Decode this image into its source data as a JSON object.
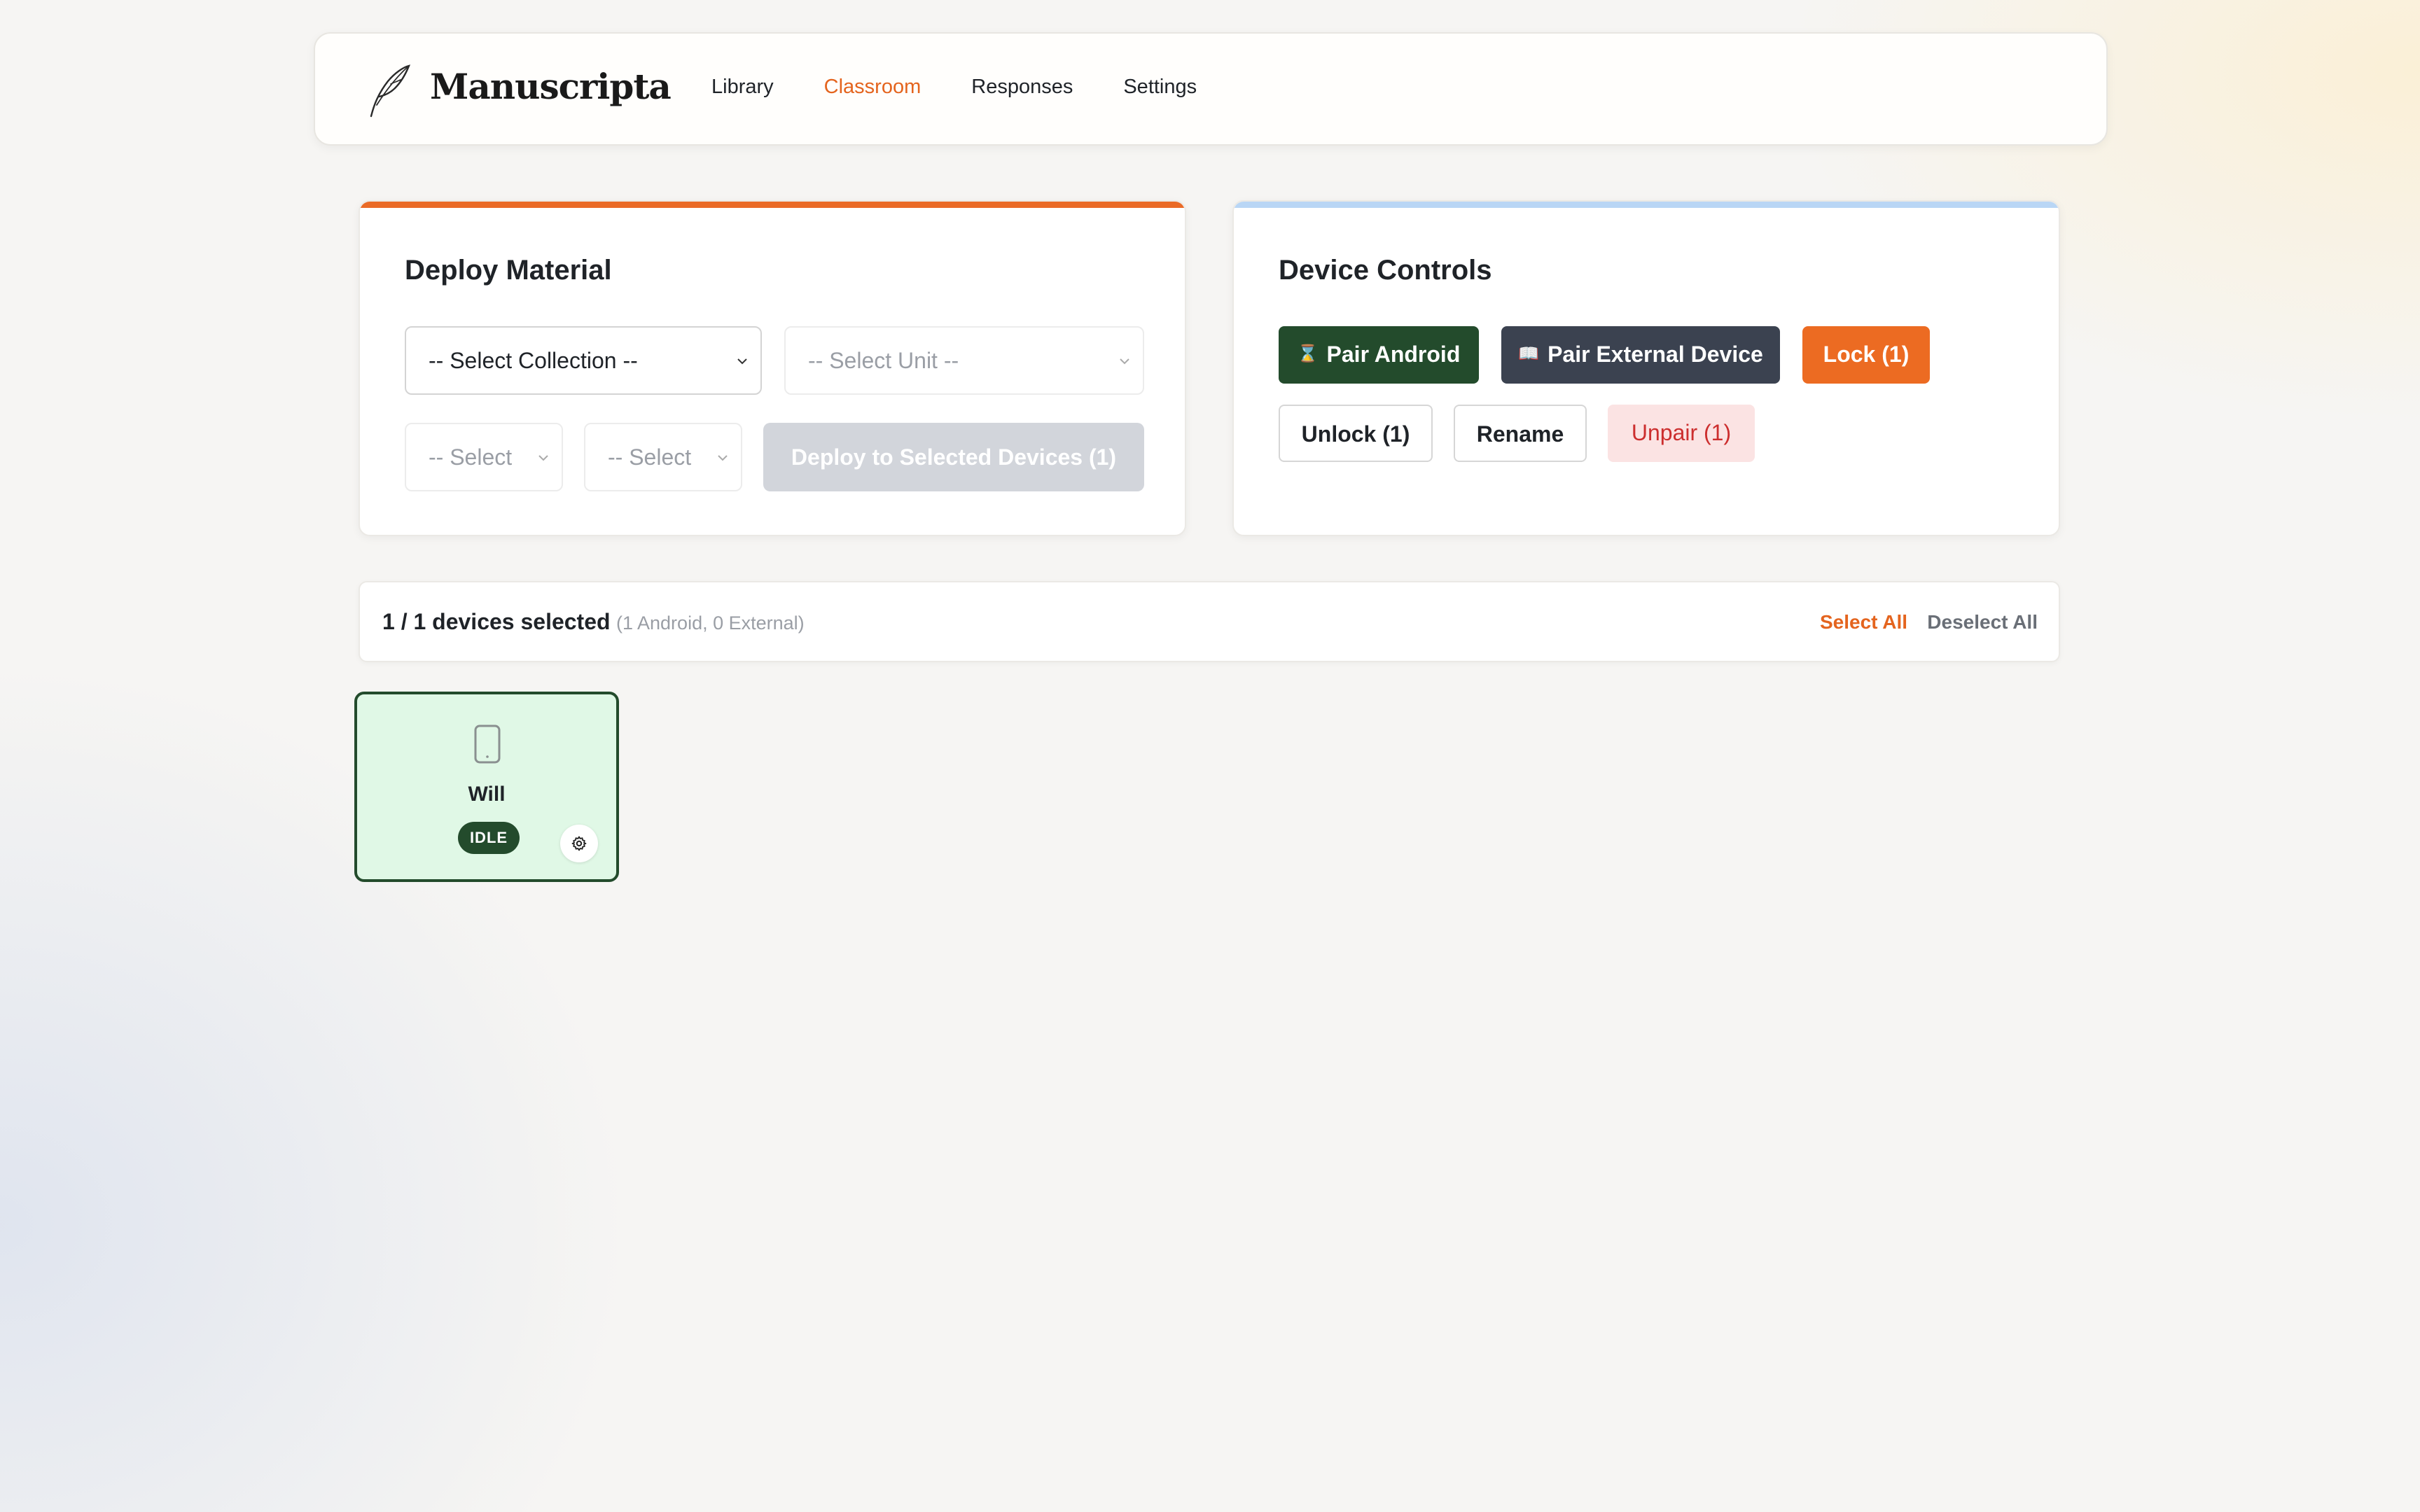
{
  "app": {
    "brand": "Manuscripta"
  },
  "nav": {
    "items": [
      {
        "label": "Library",
        "active": false
      },
      {
        "label": "Classroom",
        "active": true
      },
      {
        "label": "Responses",
        "active": false
      },
      {
        "label": "Settings",
        "active": false
      }
    ]
  },
  "deploy": {
    "title": "Deploy Material",
    "collection": {
      "value": "-- Select Collection --"
    },
    "unit": {
      "value": "-- Select Unit --"
    },
    "select_a": {
      "value": "-- Select"
    },
    "select_b": {
      "value": "-- Select"
    },
    "deploy_button": "Deploy to Selected Devices (1)"
  },
  "controls": {
    "title": "Device Controls",
    "pair_android": {
      "label": "Pair Android",
      "icon": "hourglass-icon"
    },
    "pair_external": {
      "label": "Pair External Device",
      "icon": "book-icon"
    },
    "lock": "Lock (1)",
    "unlock": "Unlock (1)",
    "rename": "Rename",
    "unpair": "Unpair (1)"
  },
  "selection": {
    "count": "1 / 1 devices selected",
    "breakdown": "(1 Android, 0 External)",
    "select_all": "Select All",
    "deselect_all": "Deselect All"
  },
  "devices": [
    {
      "name": "Will",
      "status": "IDLE",
      "selected": true,
      "icon": "phone-icon"
    }
  ],
  "colors": {
    "accent": "#e4641e",
    "green": "#234b2c",
    "slate": "#3b4250",
    "tile_bg": "#e0f8e6"
  }
}
